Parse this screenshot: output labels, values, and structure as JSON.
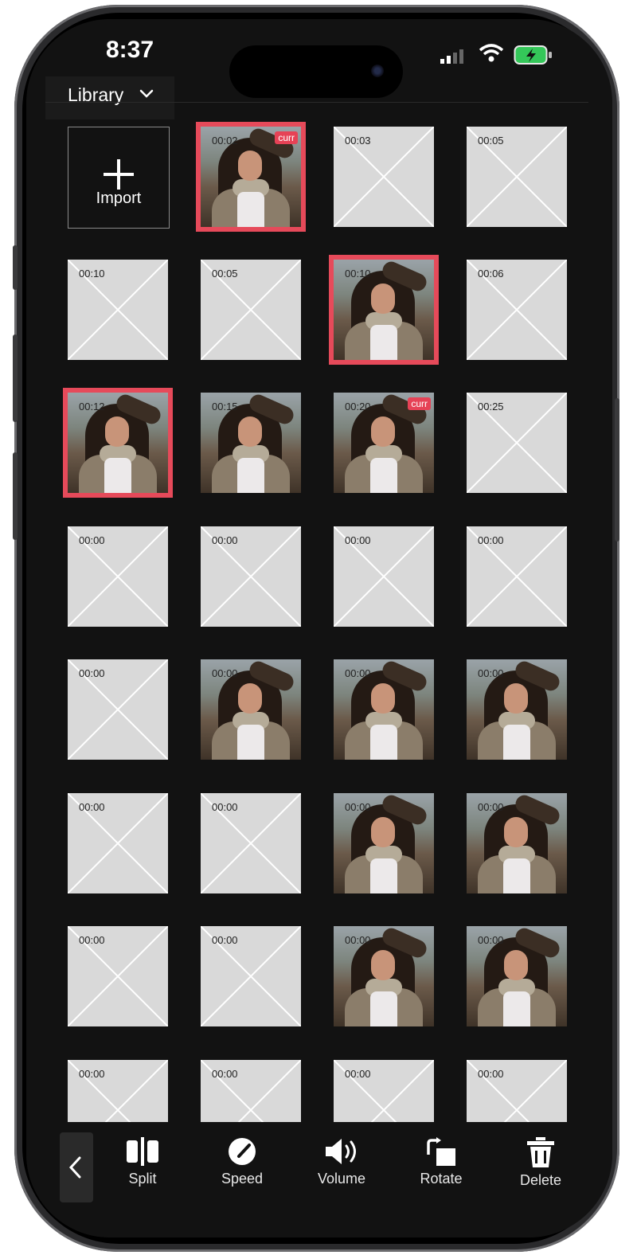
{
  "status_bar": {
    "time": "8:37"
  },
  "header": {
    "library_label": "Library"
  },
  "import": {
    "label": "Import"
  },
  "grid": {
    "cells": [
      {
        "time": "00:02",
        "type": "photo",
        "selected": true,
        "badge": "curr"
      },
      {
        "time": "00:03",
        "type": "placeholder"
      },
      {
        "time": "00:05",
        "type": "placeholder"
      },
      {
        "time": "00:10",
        "type": "placeholder"
      },
      {
        "time": "00:05",
        "type": "placeholder"
      },
      {
        "time": "00:10",
        "type": "photo",
        "selected": true
      },
      {
        "time": "00:06",
        "type": "placeholder"
      },
      {
        "time": "00:12",
        "type": "photo",
        "selected": true
      },
      {
        "time": "00:15",
        "type": "photo"
      },
      {
        "time": "00:20",
        "type": "photo",
        "badge": "curr"
      },
      {
        "time": "00:25",
        "type": "placeholder"
      },
      {
        "time": "00:00",
        "type": "placeholder"
      },
      {
        "time": "00:00",
        "type": "placeholder"
      },
      {
        "time": "00:00",
        "type": "placeholder"
      },
      {
        "time": "00:00",
        "type": "placeholder"
      },
      {
        "time": "00:00",
        "type": "placeholder"
      },
      {
        "time": "00:00",
        "type": "photo"
      },
      {
        "time": "00:00",
        "type": "photo"
      },
      {
        "time": "00:00",
        "type": "photo"
      },
      {
        "time": "00:00",
        "type": "placeholder"
      },
      {
        "time": "00:00",
        "type": "placeholder"
      },
      {
        "time": "00:00",
        "type": "photo"
      },
      {
        "time": "00:00",
        "type": "photo"
      },
      {
        "time": "00:00",
        "type": "placeholder"
      },
      {
        "time": "00:00",
        "type": "placeholder"
      },
      {
        "time": "00:00",
        "type": "photo"
      },
      {
        "time": "00:00",
        "type": "photo"
      },
      {
        "time": "00:00",
        "type": "placeholder"
      },
      {
        "time": "00:00",
        "type": "placeholder"
      },
      {
        "time": "00:00",
        "type": "placeholder"
      },
      {
        "time": "00:00",
        "type": "placeholder"
      }
    ]
  },
  "toolbar": {
    "back_icon": "chevron-left-icon",
    "tools": [
      {
        "label": "Split",
        "icon": "split-icon"
      },
      {
        "label": "Speed",
        "icon": "speed-icon"
      },
      {
        "label": "Volume",
        "icon": "volume-icon"
      },
      {
        "label": "Rotate",
        "icon": "rotate-icon"
      },
      {
        "label": "Delete",
        "icon": "trash-icon"
      }
    ]
  },
  "colors": {
    "accent": "#e64a5a",
    "background": "#121212",
    "placeholder": "#d9d9d9"
  }
}
